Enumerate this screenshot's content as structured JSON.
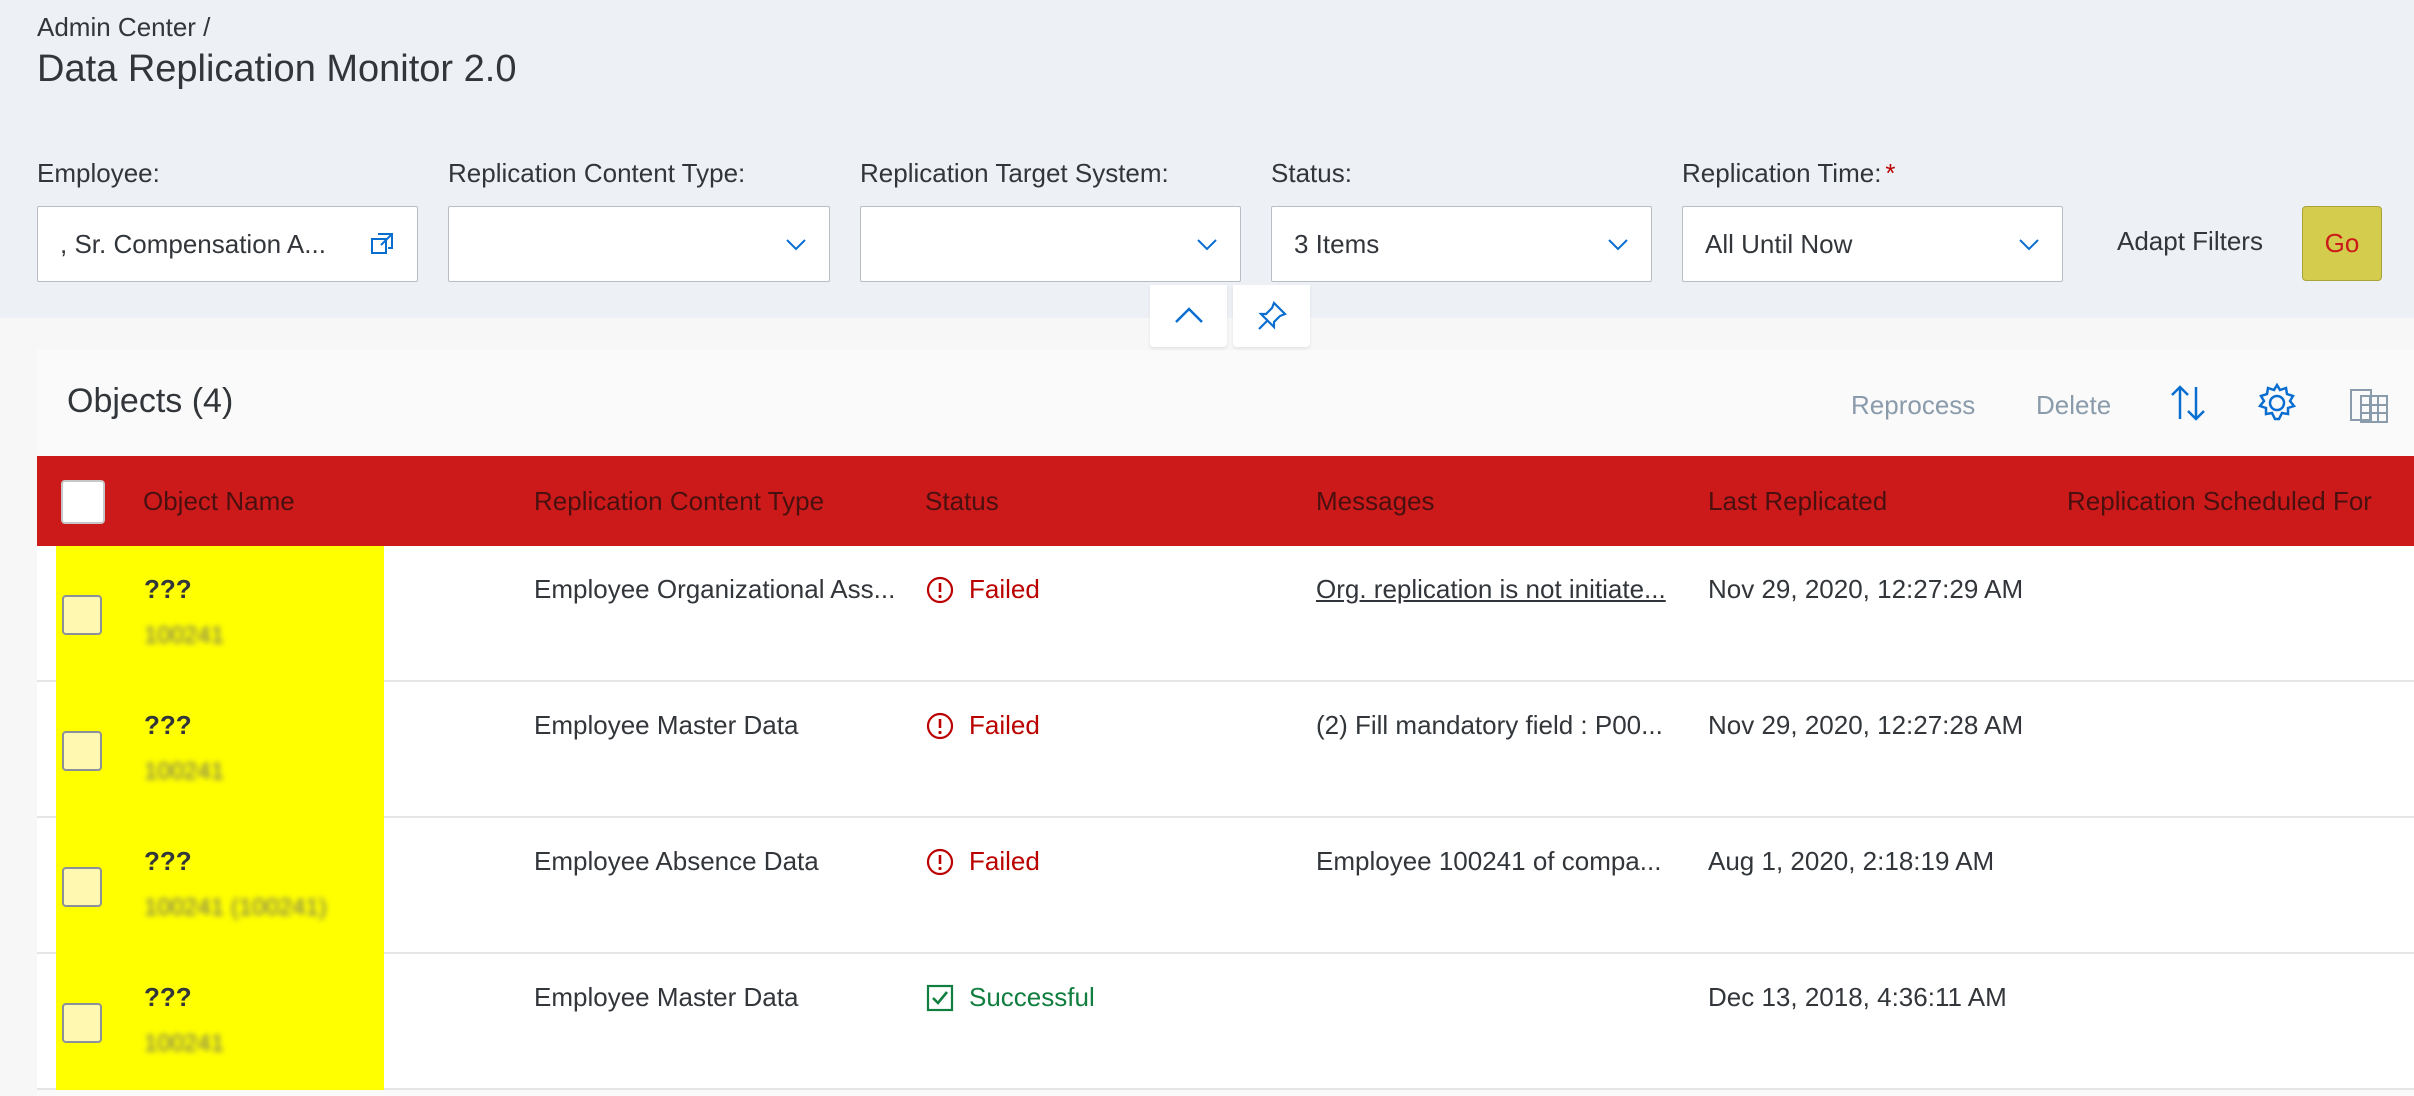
{
  "breadcrumb": "Admin Center /",
  "page_title": "Data Replication Monitor 2.0",
  "filters": {
    "employee": {
      "label": "Employee:",
      "value": ", Sr. Compensation A..."
    },
    "content_type": {
      "label": "Replication Content Type:",
      "value": ""
    },
    "target_system": {
      "label": "Replication Target System:",
      "value": ""
    },
    "status": {
      "label": "Status:",
      "value": "3 Items"
    },
    "replication_time": {
      "label": "Replication Time:",
      "required_mark": "*",
      "value": "All Until Now"
    },
    "adapt_filters_label": "Adapt Filters",
    "go_label": "Go"
  },
  "toolbar": {
    "title": "Objects (4)",
    "reprocess_label": "Reprocess",
    "delete_label": "Delete",
    "icons": [
      "sort-icon",
      "settings-icon",
      "export-icon"
    ]
  },
  "table": {
    "headers": {
      "object_name": "Object Name",
      "content_type": "Replication Content Type",
      "status": "Status",
      "messages": "Messages",
      "last_replicated": "Last Replicated",
      "scheduled_for": "Replication Scheduled For"
    },
    "rows": [
      {
        "name": "???",
        "sub": "100241",
        "content_type": "Employee Organizational Ass...",
        "status": "Failed",
        "message": "Org. replication is not initiate...",
        "last_replicated": "Nov 29, 2020, 12:27:29 AM",
        "scheduled_for": ""
      },
      {
        "name": "???",
        "sub": "100241",
        "content_type": "Employee Master Data",
        "status": "Failed",
        "message": "(2) Fill mandatory field : P00...",
        "last_replicated": "Nov 29, 2020, 12:27:28 AM",
        "scheduled_for": ""
      },
      {
        "name": "???",
        "sub": "100241 (100241)",
        "content_type": "Employee Absence Data",
        "status": "Failed",
        "message": "Employee 100241 of compa...",
        "last_replicated": "Aug 1, 2020, 2:18:19 AM",
        "scheduled_for": ""
      },
      {
        "name": "???",
        "sub": "100241",
        "content_type": "Employee Master Data",
        "status": "Successful",
        "message": "",
        "last_replicated": "Dec 13, 2018, 4:36:11 AM",
        "scheduled_for": ""
      }
    ]
  },
  "colors": {
    "header_bg": "#cc1a1a",
    "highlight": "#ffff00",
    "failed": "#bb0000",
    "success": "#107e3e",
    "link": "#3a3acc",
    "go_button": "#d4cc4d"
  }
}
